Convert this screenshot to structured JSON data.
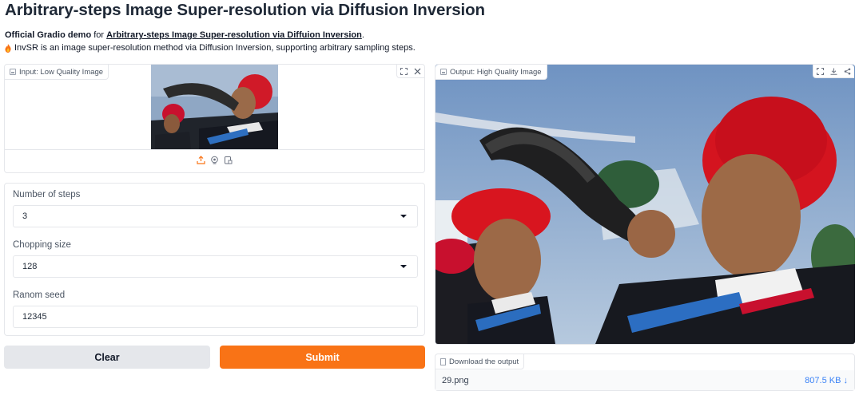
{
  "header": {
    "title": "Arbitrary-steps Image Super-resolution via Diffusion Inversion",
    "desc_bold": "Official Gradio demo",
    "desc_for": " for ",
    "desc_link": "Arbitrary-steps Image Super-resolution via Diffuion Inversion",
    "desc_end": ".",
    "desc2": "InvSR is an image super-resolution method via Diffusion Inversion, supporting arbitrary sampling steps."
  },
  "input_panel": {
    "label": "Input: Low Quality Image",
    "tools": [
      "fullscreen-icon",
      "close-icon"
    ],
    "source_icons": [
      "upload-icon",
      "webcam-icon",
      "clipboard-icon"
    ]
  },
  "form": {
    "steps": {
      "label": "Number of steps",
      "value": "3"
    },
    "chop": {
      "label": "Chopping size",
      "value": "128"
    },
    "seed": {
      "label": "Ranom seed",
      "value": "12345"
    }
  },
  "buttons": {
    "clear": "Clear",
    "submit": "Submit"
  },
  "output_panel": {
    "label": "Output: High Quality Image",
    "tools": [
      "fullscreen-icon",
      "download-icon",
      "share-icon"
    ]
  },
  "download": {
    "label": "Download the output",
    "file_name": "29.png",
    "file_size": "807.5 KB ↓"
  },
  "colors": {
    "accent": "#f97316",
    "clear_bg": "#e5e7eb",
    "link": "#3b82f6"
  }
}
